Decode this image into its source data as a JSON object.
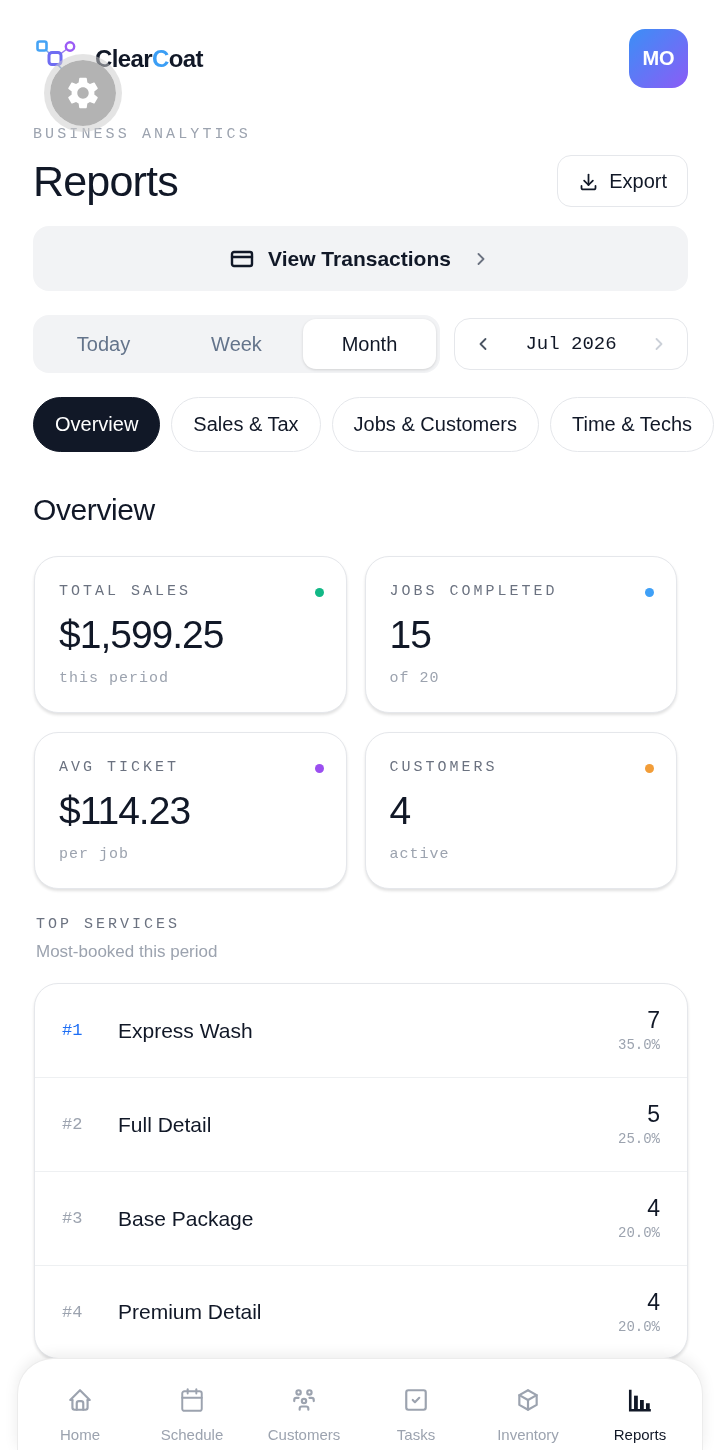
{
  "header": {
    "brand": {
      "before": "Clear",
      "accent": "C",
      "after": "oat"
    },
    "avatar": {
      "initials": "MO"
    }
  },
  "page": {
    "eyebrow": "BUSINESS ANALYTICS",
    "title": "Reports",
    "export_label": "Export"
  },
  "transactions_link": {
    "label": "View Transactions"
  },
  "periods": [
    {
      "label": "Today",
      "selected": false
    },
    {
      "label": "Week",
      "selected": false
    },
    {
      "label": "Month",
      "selected": true
    }
  ],
  "date_nav": {
    "label": "Jul 2026",
    "prev": {
      "disabled": false
    },
    "next": {
      "disabled": true
    }
  },
  "report_tabs": [
    {
      "label": "Overview",
      "selected": true
    },
    {
      "label": "Sales & Tax",
      "selected": false
    },
    {
      "label": "Jobs & Customers",
      "selected": false
    },
    {
      "label": "Time & Techs",
      "selected": false
    }
  ],
  "section_title": "Overview",
  "stats": [
    {
      "label": "TOTAL SALES",
      "value": "$1,599.25",
      "note": "this period",
      "color": "#12b886"
    },
    {
      "label": "JOBS COMPLETED",
      "value": "15",
      "note": "of 20",
      "color": "#3fa0f7"
    },
    {
      "label": "AVG TICKET",
      "value": "$114.23",
      "note": "per job",
      "color": "#9b4ff0"
    },
    {
      "label": "CUSTOMERS",
      "value": "4",
      "note": "active",
      "color": "#f29d38"
    }
  ],
  "top_services": {
    "title": "TOP SERVICES",
    "subtitle": "Most-booked this period",
    "rows": [
      {
        "rank": "#1",
        "name": "Express Wash",
        "count": "7",
        "share": "35.0%",
        "highlighted": true
      },
      {
        "rank": "#2",
        "name": "Full Detail",
        "count": "5",
        "share": "25.0%",
        "highlighted": false
      },
      {
        "rank": "#3",
        "name": "Base Package",
        "count": "4",
        "share": "20.0%",
        "highlighted": false
      },
      {
        "rank": "#4",
        "name": "Premium Detail",
        "count": "4",
        "share": "20.0%",
        "highlighted": false
      }
    ]
  },
  "nav": [
    {
      "label": "Home",
      "selected": false
    },
    {
      "label": "Schedule",
      "selected": false
    },
    {
      "label": "Customers",
      "selected": false
    },
    {
      "label": "Tasks",
      "selected": false
    },
    {
      "label": "Inventory",
      "selected": false
    },
    {
      "label": "Reports",
      "selected": true
    }
  ]
}
